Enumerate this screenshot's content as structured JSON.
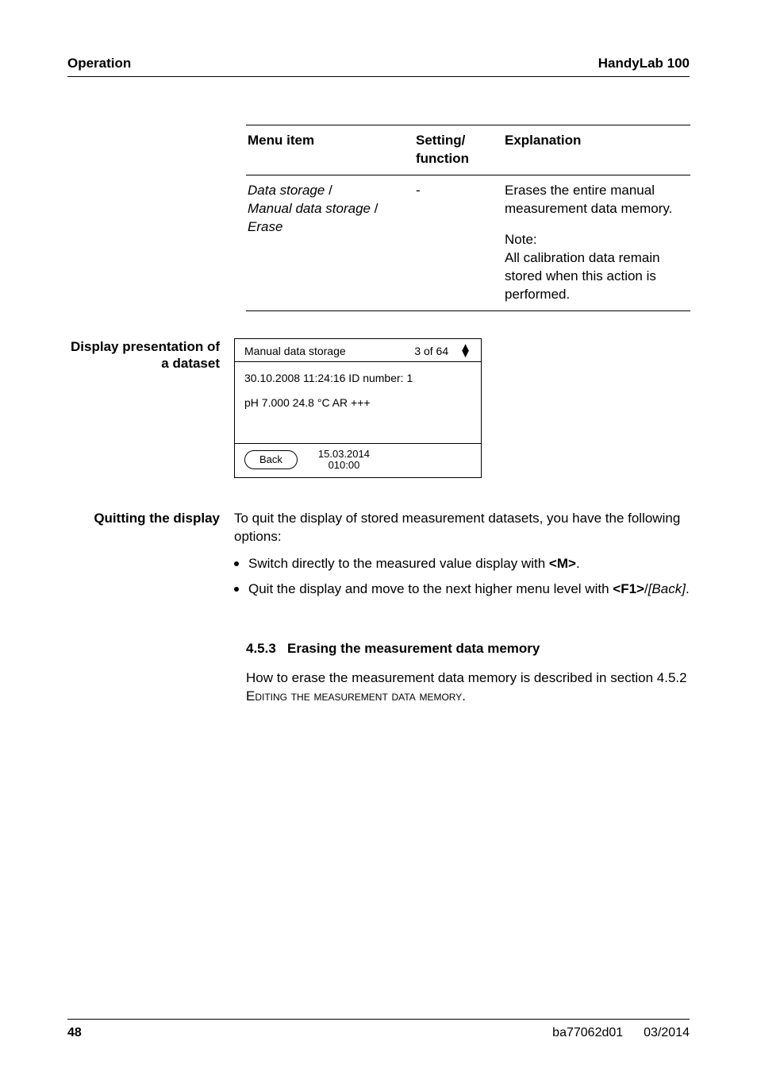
{
  "header": {
    "left": "Operation",
    "right": "HandyLab 100"
  },
  "menutable": {
    "headers": {
      "col1": "Menu item",
      "col2": "Setting/ function",
      "col3": "Explanation"
    },
    "row": {
      "item_line1": "Data storage",
      "item_line2": "Manual data storage",
      "item_line3": "Erase",
      "slash": " /",
      "setting": "-",
      "explain_main": "Erases the entire manual measurement data memory.",
      "explain_note_head": "Note:",
      "explain_note_body": "All calibration data remain stored when this action is performed."
    }
  },
  "dataset_label": {
    "line1": "Display presentation of",
    "line2": "a dataset"
  },
  "device": {
    "head_left": "Manual data storage",
    "head_right": "3 of 64",
    "arrows_up": "▲",
    "arrows_dn": "▼",
    "line1": "30.10.2008  11:24:16   ID number: 1",
    "line2": "pH 7.000    24.8 °C  AR  +++",
    "back": "Back",
    "ts1": "15.03.2014",
    "ts2": "010:00"
  },
  "quitting": {
    "label": "Quitting the display",
    "para": "To quit the display of stored measurement datasets, you have the following options:",
    "b1_pre": "Switch directly to the measured value display with ",
    "b1_key": "<M>",
    "b1_post": ".",
    "b2_pre": "Quit the display and move to the next higher menu level with ",
    "b2_key": "<F1>",
    "b2_mid": "/",
    "b2_ital": "[Back]",
    "b2_post": "."
  },
  "section": {
    "num": "4.5.3",
    "title": "Erasing the measurement data memory",
    "body_pre": "How to erase the measurement data memory is described in section 4.5.2 ",
    "body_sc": "Editing the measurement data memory",
    "body_post": "."
  },
  "footer": {
    "page": "48",
    "doc": "ba77062d01",
    "date": "03/2014"
  }
}
